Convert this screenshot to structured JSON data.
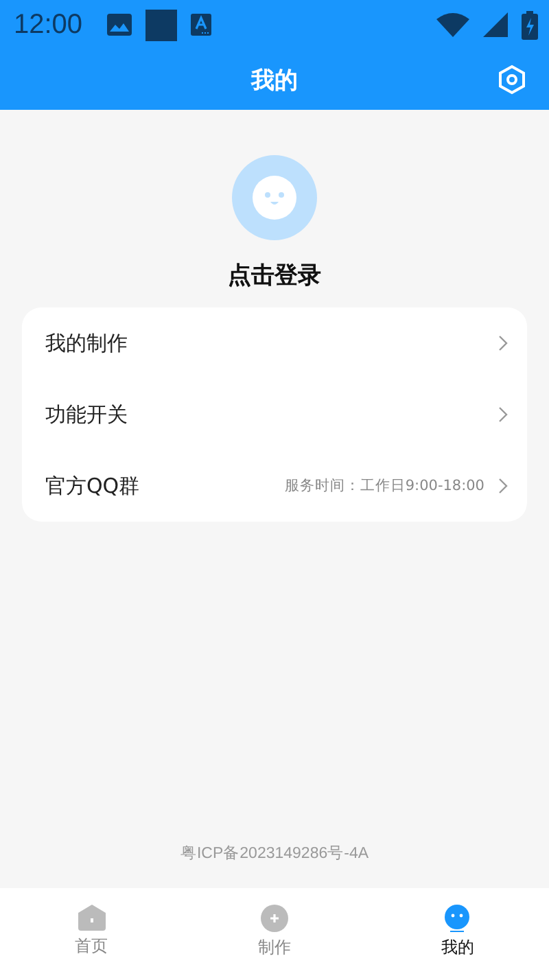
{
  "status_bar": {
    "time": "12:00"
  },
  "header": {
    "title": "我的"
  },
  "profile": {
    "login": "点击登录"
  },
  "menu": [
    {
      "label": "我的制作"
    },
    {
      "label": "功能开关"
    },
    {
      "label": "官方QQ群",
      "note": "服务时间：工作日9:00-18:00"
    }
  ],
  "footer": {
    "icp": "粤ICP备2023149286号-4A"
  },
  "tabs": [
    {
      "kind": "home",
      "label": "首页",
      "selected": false
    },
    {
      "kind": "make",
      "label": "制作",
      "selected": false
    },
    {
      "kind": "me",
      "label": "我的",
      "selected": true
    }
  ]
}
